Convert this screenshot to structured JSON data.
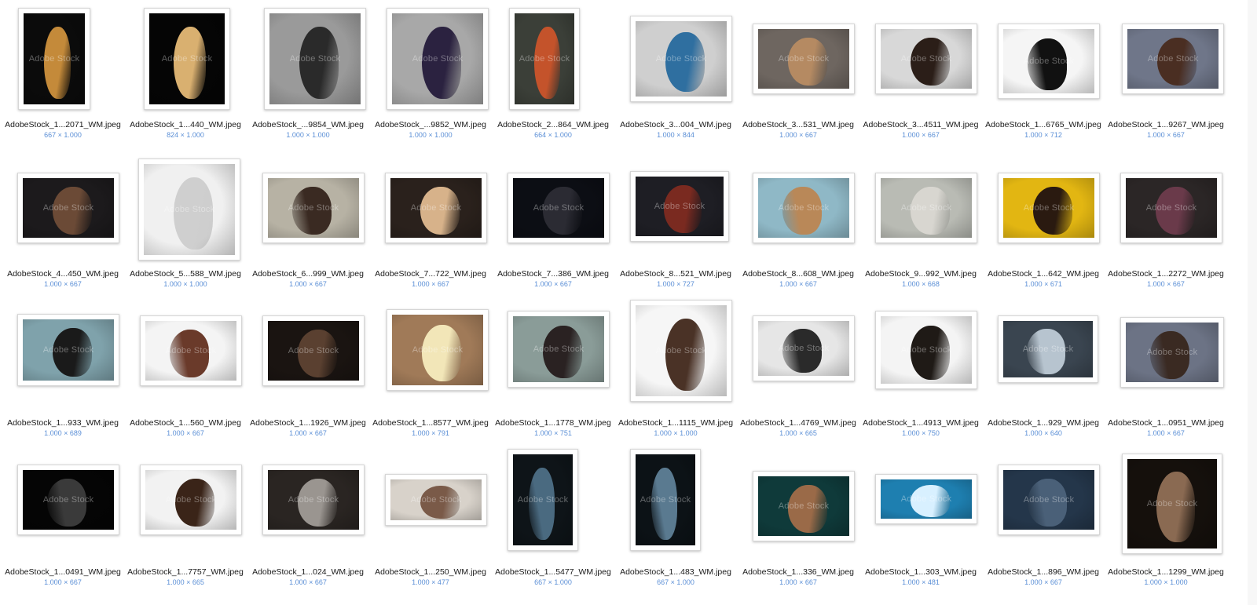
{
  "watermark": "Adobe Stock",
  "files": [
    {
      "name": "AdobeStock_1...2071_WM.jpeg",
      "dims": "667 × 1.000",
      "bg": "#0b0b0b",
      "fg": "#c48a3a",
      "profile": "right"
    },
    {
      "name": "AdobeStock_1...440_WM.jpeg",
      "dims": "824 × 1.000",
      "bg": "#050505",
      "fg": "#d9b070",
      "profile": "right"
    },
    {
      "name": "AdobeStock_...9854_WM.jpeg",
      "dims": "1.000 × 1.000",
      "bg": "#9a9a9a",
      "fg": "#2a2a2a",
      "profile": "right"
    },
    {
      "name": "AdobeStock_...9852_WM.jpeg",
      "dims": "1.000 × 1.000",
      "bg": "#a8a8a8",
      "fg": "#2b2240",
      "profile": "right"
    },
    {
      "name": "AdobeStock_2...864_WM.jpeg",
      "dims": "664 × 1.000",
      "bg": "#3b3f38",
      "fg": "#c4532b",
      "profile": "right"
    },
    {
      "name": "AdobeStock_3...004_WM.jpeg",
      "dims": "1.000 × 844",
      "bg": "#cfcfcf",
      "fg": "#2f6fa0",
      "profile": "right"
    },
    {
      "name": "AdobeStock_3...531_WM.jpeg",
      "dims": "1.000 × 667",
      "bg": "#6e6660",
      "fg": "#b58a62",
      "profile": "right"
    },
    {
      "name": "AdobeStock_3...4511_WM.jpeg",
      "dims": "1.000 × 667",
      "bg": "#d8d8d8",
      "fg": "#2b1e18",
      "profile": "right"
    },
    {
      "name": "AdobeStock_1...6765_WM.jpeg",
      "dims": "1.000 × 712",
      "bg": "#f5f5f5",
      "fg": "#111111",
      "profile": "left"
    },
    {
      "name": "AdobeStock_1...9267_WM.jpeg",
      "dims": "1.000 × 667",
      "bg": "#6f7689",
      "fg": "#4a2e22",
      "profile": "right"
    },
    {
      "name": "AdobeStock_4...450_WM.jpeg",
      "dims": "1.000 × 667",
      "bg": "#1c1a1c",
      "fg": "#6b4a36",
      "profile": "right"
    },
    {
      "name": "AdobeStock_5...588_WM.jpeg",
      "dims": "1.000 × 1.000",
      "bg": "#f0f0f0",
      "fg": "#cfcfcf",
      "profile": "right"
    },
    {
      "name": "AdobeStock_6...999_WM.jpeg",
      "dims": "1.000 × 667",
      "bg": "#b7b2a4",
      "fg": "#3a2a22",
      "profile": "left"
    },
    {
      "name": "AdobeStock_7...722_WM.jpeg",
      "dims": "1.000 × 667",
      "bg": "#2a211c",
      "fg": "#d7b28a",
      "profile": "right"
    },
    {
      "name": "AdobeStock_7...386_WM.jpeg",
      "dims": "1.000 × 667",
      "bg": "#0c0e14",
      "fg": "#2b2b33",
      "profile": "right"
    },
    {
      "name": "AdobeStock_8...521_WM.jpeg",
      "dims": "1.000 × 727",
      "bg": "#1e1e24",
      "fg": "#7a2a20",
      "profile": "right"
    },
    {
      "name": "AdobeStock_8...608_WM.jpeg",
      "dims": "1.000 × 667",
      "bg": "#8fb8c6",
      "fg": "#b98858",
      "profile": "left"
    },
    {
      "name": "AdobeStock_9...992_WM.jpeg",
      "dims": "1.000 × 668",
      "bg": "#b9bbb4",
      "fg": "#d8d6d0",
      "profile": "right"
    },
    {
      "name": "AdobeStock_1...642_WM.jpeg",
      "dims": "1.000 × 671",
      "bg": "#e2b612",
      "fg": "#2a1a10",
      "profile": "right"
    },
    {
      "name": "AdobeStock_1...2272_WM.jpeg",
      "dims": "1.000 × 667",
      "bg": "#2b2626",
      "fg": "#6a3a4a",
      "profile": "right"
    },
    {
      "name": "AdobeStock_1...933_WM.jpeg",
      "dims": "1.000 × 689",
      "bg": "#7fa2ab",
      "fg": "#1a1a1a",
      "profile": "right"
    },
    {
      "name": "AdobeStock_1...560_WM.jpeg",
      "dims": "1.000 × 667",
      "bg": "#f4f4f4",
      "fg": "#6a3a2a",
      "profile": "left"
    },
    {
      "name": "AdobeStock_1...1926_WM.jpeg",
      "dims": "1.000 × 667",
      "bg": "#1a1411",
      "fg": "#5a4030",
      "profile": "right"
    },
    {
      "name": "AdobeStock_1...8577_WM.jpeg",
      "dims": "1.000 × 791",
      "bg": "#a07a58",
      "fg": "#f2e6b8",
      "profile": "right"
    },
    {
      "name": "AdobeStock_1...1778_WM.jpeg",
      "dims": "1.000 × 751",
      "bg": "#8a9c98",
      "fg": "#2a2222",
      "profile": "right"
    },
    {
      "name": "AdobeStock_1...1115_WM.jpeg",
      "dims": "1.000 × 1.000",
      "bg": "#f6f6f6",
      "fg": "#4a3226",
      "profile": "right"
    },
    {
      "name": "AdobeStock_1...4769_WM.jpeg",
      "dims": "1.000 × 665",
      "bg": "#e6e6e6",
      "fg": "#2a2a2a",
      "profile": "left"
    },
    {
      "name": "AdobeStock_1...4913_WM.jpeg",
      "dims": "1.000 × 750",
      "bg": "#f4f4f4",
      "fg": "#1f1a16",
      "profile": "right"
    },
    {
      "name": "AdobeStock_1...929_WM.jpeg",
      "dims": "1.000 × 640",
      "bg": "#3a4550",
      "fg": "#b7c4cf",
      "profile": "left"
    },
    {
      "name": "AdobeStock_1...0951_WM.jpeg",
      "dims": "1.000 × 667",
      "bg": "#6c7385",
      "fg": "#3a2a22",
      "profile": "left"
    },
    {
      "name": "AdobeStock_1...0491_WM.jpeg",
      "dims": "1.000 × 667",
      "bg": "#050505",
      "fg": "#3a3a3a",
      "profile": "left"
    },
    {
      "name": "AdobeStock_1...7757_WM.jpeg",
      "dims": "1.000 × 665",
      "bg": "#f2f2f2",
      "fg": "#3a2418",
      "profile": "right"
    },
    {
      "name": "AdobeStock_1...024_WM.jpeg",
      "dims": "1.000 × 667",
      "bg": "#2a2522",
      "fg": "#9a9590",
      "profile": "right"
    },
    {
      "name": "AdobeStock_1...250_WM.jpeg",
      "dims": "1.000 × 477",
      "bg": "#d8d2ca",
      "fg": "#7a5a48",
      "profile": "right"
    },
    {
      "name": "AdobeStock_1...5477_WM.jpeg",
      "dims": "667 × 1.000",
      "bg": "#0e1418",
      "fg": "#4a6a80",
      "profile": "left"
    },
    {
      "name": "AdobeStock_1...483_WM.jpeg",
      "dims": "667 × 1.000",
      "bg": "#0c1216",
      "fg": "#5a7a90",
      "profile": "left"
    },
    {
      "name": "AdobeStock_1...336_WM.jpeg",
      "dims": "1.000 × 667",
      "bg": "#0f3a3a",
      "fg": "#9a6a48",
      "profile": "right"
    },
    {
      "name": "AdobeStock_1...303_WM.jpeg",
      "dims": "1.000 × 481",
      "bg": "#1e7fb0",
      "fg": "#d8f0ff",
      "profile": "right"
    },
    {
      "name": "AdobeStock_1...896_WM.jpeg",
      "dims": "1.000 × 667",
      "bg": "#24364a",
      "fg": "#4a6078",
      "profile": "left"
    },
    {
      "name": "AdobeStock_1...1299_WM.jpeg",
      "dims": "1.000 × 1.000",
      "bg": "#15100c",
      "fg": "#8a6a52",
      "profile": "right"
    }
  ]
}
